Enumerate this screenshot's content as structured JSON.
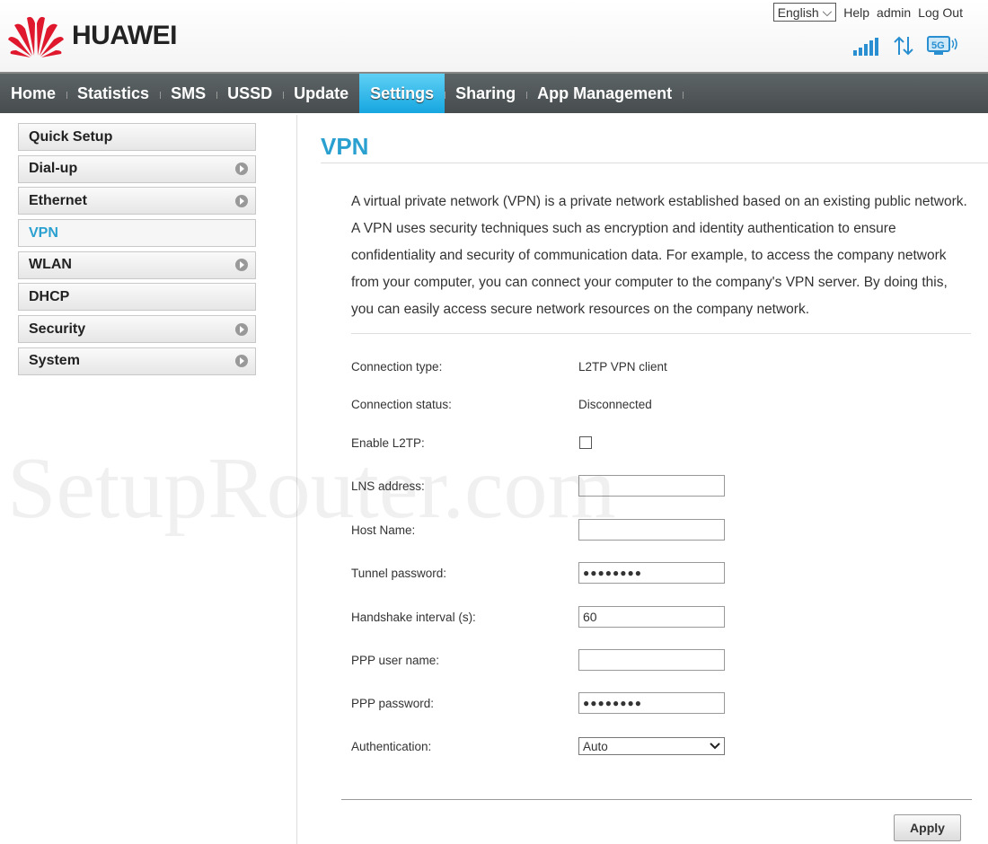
{
  "header": {
    "brand": "HUAWEI",
    "language": "English",
    "links": [
      "Help",
      "admin",
      "Log Out"
    ],
    "status_icons": [
      "signal-icon",
      "data-transfer-icon",
      "5g-wifi-icon"
    ]
  },
  "nav": {
    "items": [
      "Home",
      "Statistics",
      "SMS",
      "USSD",
      "Update",
      "Settings",
      "Sharing",
      "App Management"
    ],
    "active": "Settings"
  },
  "sidebar": {
    "items": [
      {
        "label": "Quick Setup",
        "arrow": false
      },
      {
        "label": "Dial-up",
        "arrow": true
      },
      {
        "label": "Ethernet",
        "arrow": true
      },
      {
        "label": "VPN",
        "arrow": false,
        "active": true
      },
      {
        "label": "WLAN",
        "arrow": true
      },
      {
        "label": "DHCP",
        "arrow": false
      },
      {
        "label": "Security",
        "arrow": true
      },
      {
        "label": "System",
        "arrow": true
      }
    ]
  },
  "main": {
    "title": "VPN",
    "description": "A virtual private network (VPN) is a private network established based on an existing public network. A VPN uses security techniques such as encryption and identity authentication to ensure confidentiality and security of communication data. For example, to access the company network from your computer, you can connect your computer to the company's VPN server. By doing this, you can easily access secure network resources on the company network.",
    "fields": {
      "connection_type": {
        "label": "Connection type:",
        "value": "L2TP VPN client"
      },
      "connection_status": {
        "label": "Connection status:",
        "value": "Disconnected"
      },
      "enable_l2tp": {
        "label": "Enable L2TP:",
        "checked": false
      },
      "lns_address": {
        "label": "LNS address:",
        "value": ""
      },
      "host_name": {
        "label": "Host Name:",
        "value": ""
      },
      "tunnel_password": {
        "label": "Tunnel password:",
        "value": "●●●●●●●●"
      },
      "handshake_interval": {
        "label": "Handshake interval (s):",
        "value": "60"
      },
      "ppp_user_name": {
        "label": "PPP user name:",
        "value": ""
      },
      "ppp_password": {
        "label": "PPP password:",
        "value": "●●●●●●●●"
      },
      "authentication": {
        "label": "Authentication:",
        "value": "Auto"
      }
    },
    "apply_label": "Apply"
  },
  "watermark": "SetupRouter.com",
  "colors": {
    "accent": "#2aa0d0",
    "nav_bg": "#4f5658",
    "nav_active": "#16a6e0"
  }
}
